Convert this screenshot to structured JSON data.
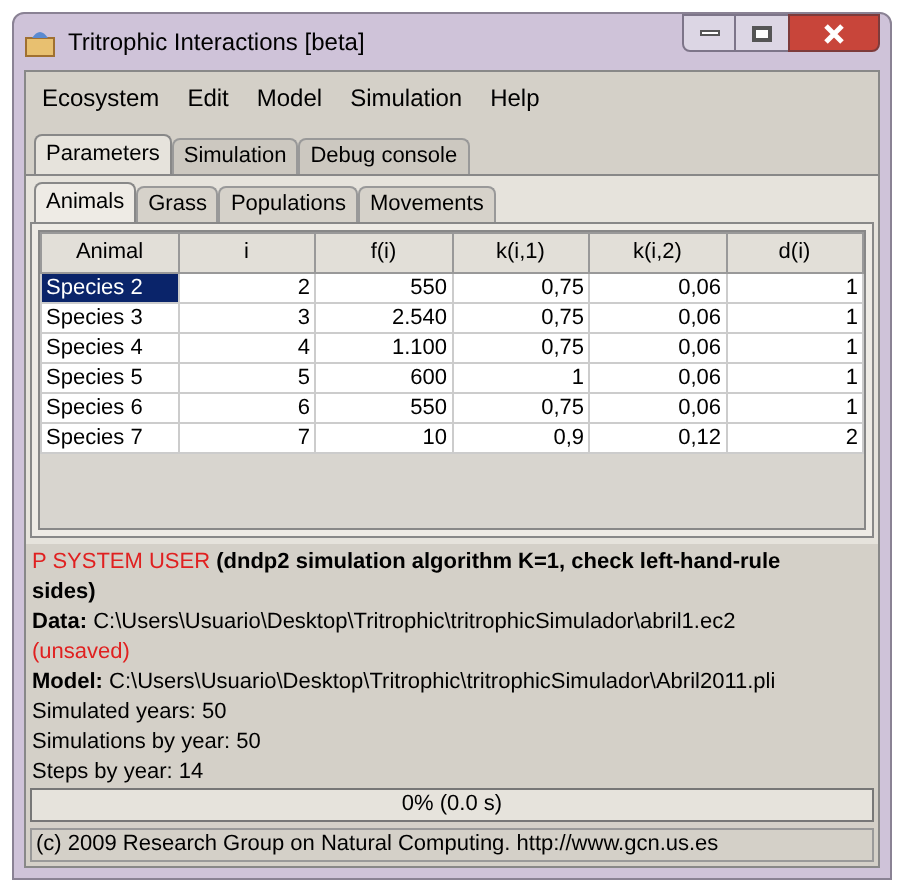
{
  "window": {
    "title": "Tritrophic Interactions [beta]"
  },
  "menu": [
    "Ecosystem",
    "Edit",
    "Model",
    "Simulation",
    "Help"
  ],
  "tabs": [
    {
      "label": "Parameters",
      "selected": true
    },
    {
      "label": "Simulation",
      "selected": false
    },
    {
      "label": "Debug console",
      "selected": false
    }
  ],
  "subtabs": [
    {
      "label": "Animals",
      "selected": true
    },
    {
      "label": "Grass",
      "selected": false
    },
    {
      "label": "Populations",
      "selected": false
    },
    {
      "label": "Movements",
      "selected": false
    }
  ],
  "table": {
    "columns": [
      "Animal",
      "i",
      "f(i)",
      "k(i,1)",
      "k(i,2)",
      "d(i)"
    ],
    "rows": [
      {
        "cells": [
          "Species 2",
          "2",
          "550",
          "0,75",
          "0,06",
          "1"
        ],
        "selected": true
      },
      {
        "cells": [
          "Species 3",
          "3",
          "2.540",
          "0,75",
          "0,06",
          "1"
        ],
        "selected": false
      },
      {
        "cells": [
          "Species 4",
          "4",
          "1.100",
          "0,75",
          "0,06",
          "1"
        ],
        "selected": false
      },
      {
        "cells": [
          "Species 5",
          "5",
          "600",
          "1",
          "0,06",
          "1"
        ],
        "selected": false
      },
      {
        "cells": [
          "Species 6",
          "6",
          "550",
          "0,75",
          "0,06",
          "1"
        ],
        "selected": false
      },
      {
        "cells": [
          "Species 7",
          "7",
          "10",
          "0,9",
          "0,12",
          "2"
        ],
        "selected": false
      }
    ]
  },
  "info": {
    "user": "P SYSTEM USER",
    "algorithm": "(dndp2 simulation algorithm K=1, check left-hand-rule sides)",
    "lines": [
      {
        "text": "**Data:** C:\\Users\\Usuario\\Desktop\\Tritrophic\\tritrophicSimulador\\abril1.ec2",
        "status": "(unsaved)"
      },
      {
        "text": "**Model:** C:\\Users\\Usuario\\Desktop\\Tritrophic\\tritrophicSimulador\\Abril2011.pli"
      },
      {
        "text": "Simulated years: 50"
      },
      {
        "text": "Simulations by year: 50"
      },
      {
        "text": "Steps by year: 14"
      }
    ]
  },
  "progress": {
    "label": "0% (0.0 s)"
  },
  "status_bar": "(c) 2009 Research Group on Natural Computing. http://www.gcn.us.es"
}
